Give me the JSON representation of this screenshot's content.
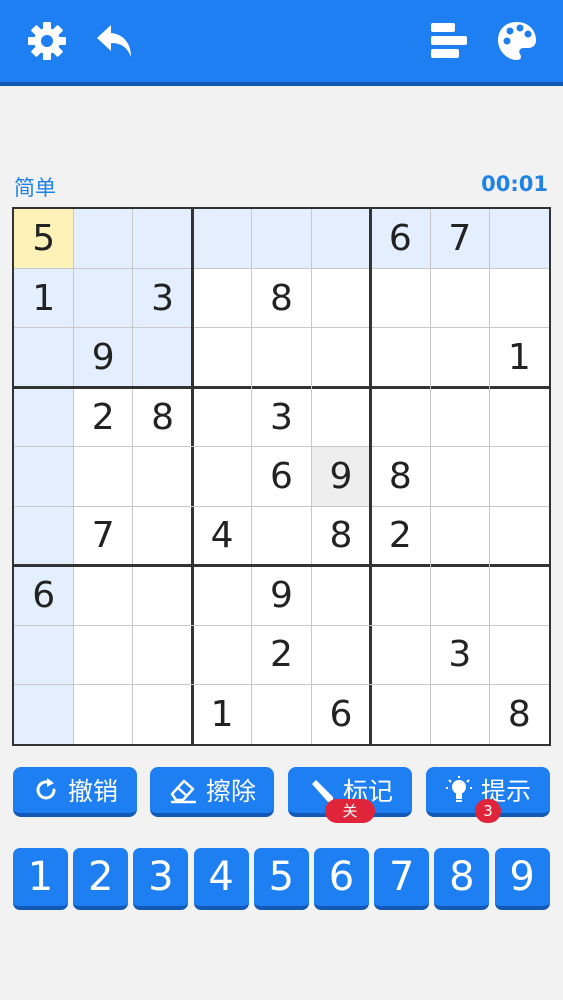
{
  "header": {
    "settings_icon": "gear-icon",
    "undo_icon": "undo-arrow-icon",
    "stats_icon": "bars-icon",
    "theme_icon": "palette-icon"
  },
  "game": {
    "difficulty": "简单",
    "timer": "00:01"
  },
  "board": {
    "rows": [
      [
        "5",
        "",
        "",
        "",
        "",
        "",
        "6",
        "7",
        ""
      ],
      [
        "1",
        "",
        "3",
        "",
        "8",
        "",
        "",
        "",
        ""
      ],
      [
        "",
        "9",
        "",
        "",
        "",
        "",
        "",
        "",
        "1"
      ],
      [
        "",
        "2",
        "8",
        "",
        "3",
        "",
        "",
        "",
        ""
      ],
      [
        "",
        "",
        "",
        "",
        "6",
        "9",
        "8",
        "",
        ""
      ],
      [
        "",
        "7",
        "",
        "4",
        "",
        "8",
        "2",
        "",
        ""
      ],
      [
        "6",
        "",
        "",
        "",
        "9",
        "",
        "",
        "",
        ""
      ],
      [
        "",
        "",
        "",
        "",
        "2",
        "",
        "",
        "3",
        ""
      ],
      [
        "",
        "",
        "",
        "1",
        "",
        "6",
        "",
        "",
        "8"
      ]
    ],
    "selected_cell": [
      0,
      0
    ]
  },
  "actions": {
    "undo": {
      "label": "撤销",
      "icon": "redo-circle-icon"
    },
    "erase": {
      "label": "擦除",
      "icon": "eraser-icon"
    },
    "notes": {
      "label": "标记",
      "icon": "pencil-icon",
      "badge": "关"
    },
    "hint": {
      "label": "提示",
      "icon": "lightbulb-icon",
      "badge": "3"
    }
  },
  "numpad": [
    "1",
    "2",
    "3",
    "4",
    "5",
    "6",
    "7",
    "8",
    "9"
  ],
  "colors": {
    "primary": "#1e7ff2",
    "primary_dark": "#1259b5",
    "highlight": "#e3efff",
    "selected": "#fff2b8",
    "badge": "#e0253a"
  }
}
